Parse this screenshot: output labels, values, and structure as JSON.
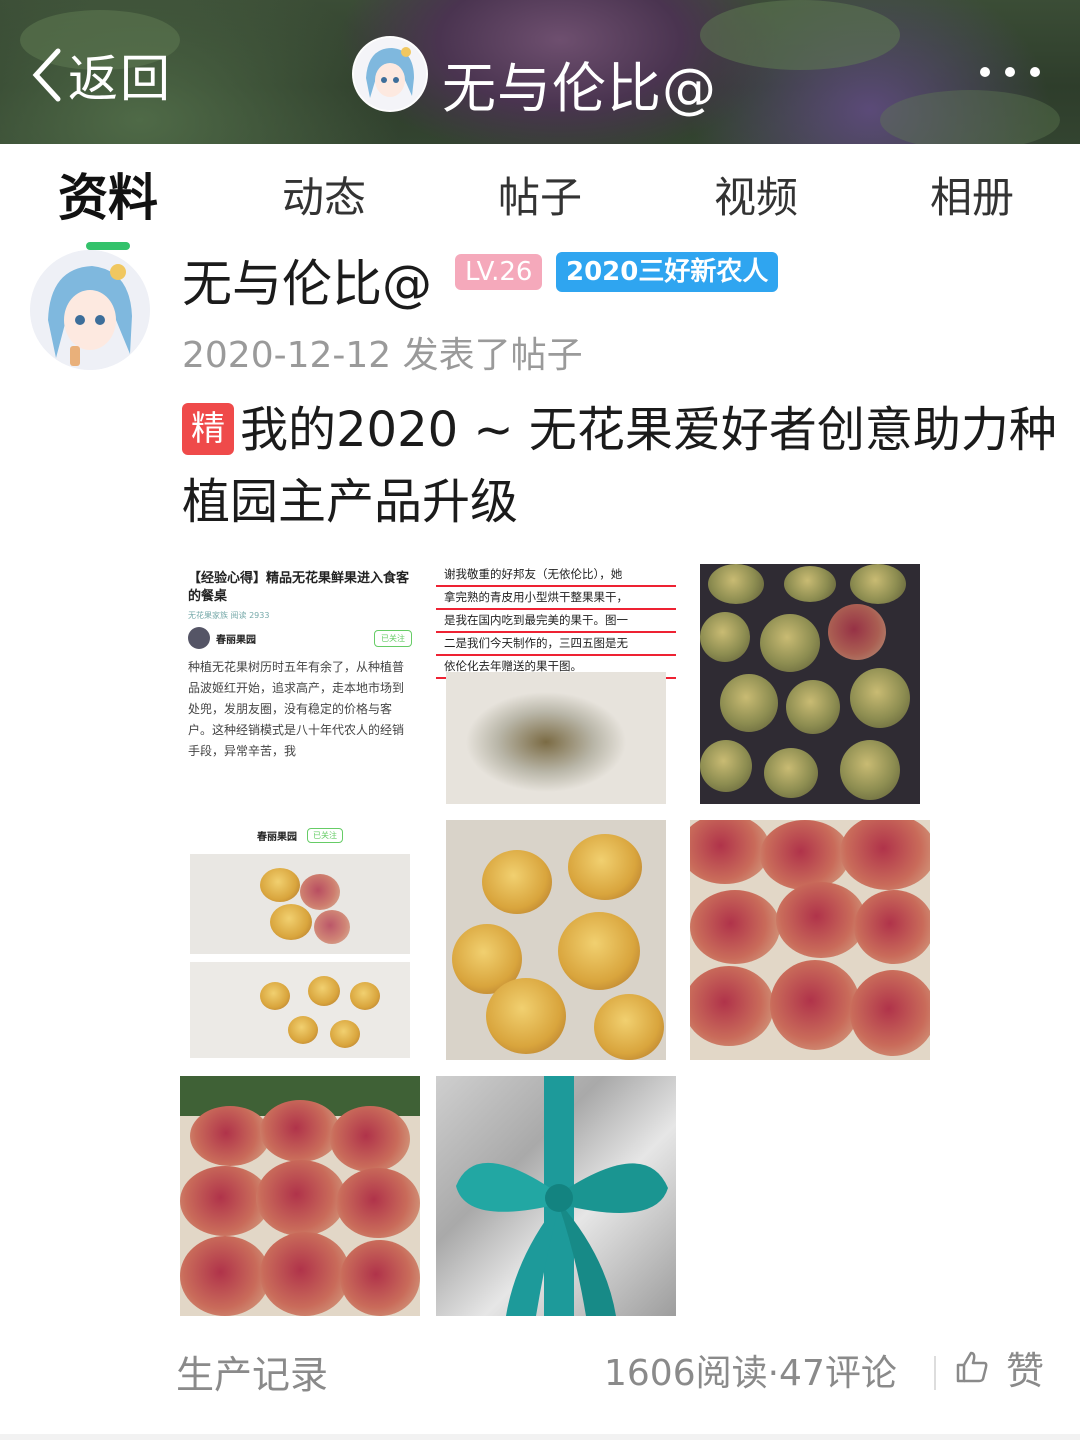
{
  "header": {
    "back_label": "返回",
    "title": "无与伦比@"
  },
  "tabs": [
    {
      "label": "资料",
      "active": true
    },
    {
      "label": "动态",
      "active": false
    },
    {
      "label": "帖子",
      "active": false
    },
    {
      "label": "视频",
      "active": false
    },
    {
      "label": "相册",
      "active": false
    }
  ],
  "post": {
    "author": "无与伦比@",
    "level_badge": "LV.26",
    "title_badge": "2020三好新农人",
    "date_line": "2020-12-12 发表了帖子",
    "featured_tag": "精",
    "title": "我的2020 ~ 无花果爱好者创意助力种植园主产品升级",
    "images": [
      {
        "headline": "【经验心得】精品无花果鲜果进入食客的餐桌",
        "meta": "无花果家族   阅读 2933",
        "user": "春丽果园",
        "follow": "已关注",
        "body": "种植无花果树历时五年有余了，从种植普品波姬红开始，追求高产，走本地市场到处兜，发朋友圈，没有稳定的价格与客户。这种经销模式是八十年代农人的经销手段，异常辛苦，我"
      },
      {
        "lines": [
          "谢我敬重的好邦友（无依伦比），她",
          "拿完熟的青皮用小型烘干整果果干，",
          "是我在国内吃到最完美的果干。图一",
          "二是我们今天制作的，三四五图是无",
          "依伦化去年赠送的果干图。"
        ]
      },
      {
        "subject": "dried figs on tray"
      },
      {
        "subject": "jar and tray of dried figs",
        "user": "春丽果园",
        "follow": "已关注"
      },
      {
        "subject": "yellow dried figs"
      },
      {
        "subject": "red dried figs pile"
      },
      {
        "subject": "red dried figs pile"
      },
      {
        "subject": "gift package with teal ribbon"
      }
    ],
    "tag": "生产记录",
    "stats": "1606阅读·47评论",
    "like_label": "赞"
  },
  "icons": {
    "back": "chevron-left-icon",
    "more": "more-dots-icon",
    "like": "thumbs-up-icon"
  }
}
